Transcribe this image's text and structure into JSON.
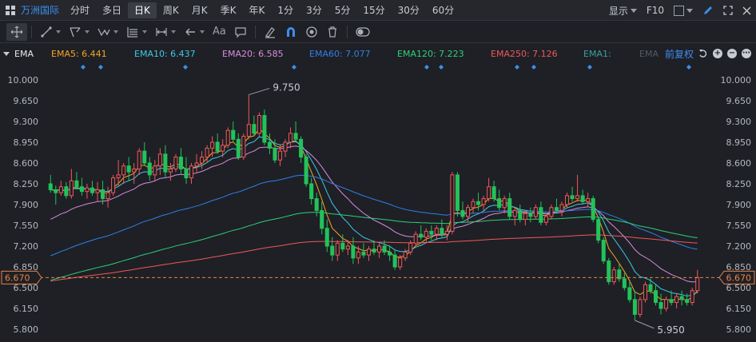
{
  "stock": {
    "name": "万洲国际"
  },
  "periods": [
    "分时",
    "多日",
    "日K",
    "周K",
    "月K",
    "季K",
    "年K",
    "1分",
    "3分",
    "5分",
    "15分",
    "30分",
    "60分"
  ],
  "active_period": "日K",
  "top_right": {
    "display_label": "显示",
    "f10_label": "F10"
  },
  "toolbar": {
    "tools": [
      {
        "name": "move-tool",
        "icon": "cross-arrows-icon",
        "caret": false,
        "active": true
      },
      {
        "name": "line-tool",
        "icon": "line-icon",
        "caret": true
      },
      {
        "name": "channel-tool",
        "icon": "channel-icon",
        "caret": true
      },
      {
        "name": "wave-tool",
        "icon": "wave-icon",
        "caret": true
      },
      {
        "name": "fib-tool",
        "icon": "fib-icon",
        "caret": true
      },
      {
        "name": "range-tool",
        "icon": "range-icon",
        "caret": true
      },
      {
        "name": "arrow-tool",
        "icon": "arrow-left-icon",
        "caret": true
      },
      {
        "name": "text-tool",
        "icon": "text-icon",
        "caret": false
      },
      {
        "name": "comment-tool",
        "icon": "comment-icon",
        "caret": false
      }
    ],
    "text_tool_label": "Aa"
  },
  "indicator": {
    "name": "EMA",
    "items": [
      {
        "label": "EMA5: 6.441",
        "color": "#f5a623"
      },
      {
        "label": "EMA10: 6.437",
        "color": "#3fc8e8"
      },
      {
        "label": "EMA20: 6.585",
        "color": "#d98be0"
      },
      {
        "label": "EMA60: 7.077",
        "color": "#2f7fe8"
      },
      {
        "label": "EMA120: 7.223",
        "color": "#2fcf7a"
      },
      {
        "label": "EMA250: 7.126",
        "color": "#f0575a"
      },
      {
        "label": "EMA1:",
        "color": "#3aa0a0"
      },
      {
        "label": "EMA",
        "color": "#555a62"
      }
    ],
    "adjust_label": "前复权"
  },
  "chart_data": {
    "type": "candlestick",
    "y_ticks": [
      "10.000",
      "9.650",
      "9.300",
      "8.950",
      "8.600",
      "8.250",
      "7.900",
      "7.550",
      "7.200",
      "6.850",
      "6.500",
      "6.150",
      "5.800"
    ],
    "ylim": [
      5.8,
      10.0
    ],
    "current_price": "6.670",
    "high_label": "9.750",
    "low_label": "5.950",
    "up_color": "#f0575a",
    "down_color": "#23c25a",
    "candles": [
      [
        8.25,
        8.4,
        8.1,
        8.15
      ],
      [
        8.15,
        8.22,
        7.9,
        8.1
      ],
      [
        8.1,
        8.3,
        8.05,
        8.2
      ],
      [
        8.2,
        8.28,
        8.0,
        8.05
      ],
      [
        8.05,
        8.5,
        8.0,
        8.3
      ],
      [
        8.3,
        8.45,
        8.15,
        8.2
      ],
      [
        8.2,
        8.35,
        8.05,
        8.12
      ],
      [
        8.12,
        8.25,
        8.0,
        8.18
      ],
      [
        8.18,
        8.3,
        8.05,
        8.1
      ],
      [
        8.1,
        8.28,
        7.95,
        8.15
      ],
      [
        8.15,
        8.3,
        7.9,
        8.0
      ],
      [
        8.0,
        8.2,
        7.85,
        8.1
      ],
      [
        8.1,
        8.4,
        8.05,
        8.35
      ],
      [
        8.35,
        8.65,
        8.2,
        8.4
      ],
      [
        8.4,
        8.6,
        8.25,
        8.55
      ],
      [
        8.55,
        8.7,
        8.3,
        8.45
      ],
      [
        8.45,
        8.6,
        8.25,
        8.5
      ],
      [
        8.5,
        8.85,
        8.4,
        8.8
      ],
      [
        8.8,
        8.95,
        8.55,
        8.6
      ],
      [
        8.6,
        8.7,
        8.3,
        8.4
      ],
      [
        8.4,
        8.65,
        8.3,
        8.55
      ],
      [
        8.55,
        8.85,
        8.4,
        8.75
      ],
      [
        8.75,
        8.9,
        8.35,
        8.45
      ],
      [
        8.45,
        8.6,
        8.3,
        8.5
      ],
      [
        8.5,
        8.75,
        8.45,
        8.7
      ],
      [
        8.7,
        8.85,
        8.4,
        8.5
      ],
      [
        8.5,
        8.7,
        8.25,
        8.35
      ],
      [
        8.35,
        8.6,
        8.25,
        8.55
      ],
      [
        8.55,
        8.75,
        8.45,
        8.6
      ],
      [
        8.6,
        8.8,
        8.5,
        8.7
      ],
      [
        8.7,
        8.9,
        8.6,
        8.85
      ],
      [
        8.85,
        9.05,
        8.7,
        8.95
      ],
      [
        8.95,
        9.1,
        8.75,
        8.8
      ],
      [
        8.8,
        9.0,
        8.7,
        8.9
      ],
      [
        8.9,
        9.2,
        8.85,
        9.15
      ],
      [
        9.15,
        9.3,
        8.95,
        9.0
      ],
      [
        9.0,
        9.1,
        8.65,
        8.7
      ],
      [
        8.7,
        9.1,
        8.65,
        9.05
      ],
      [
        9.05,
        9.75,
        9.0,
        9.25
      ],
      [
        9.25,
        9.4,
        9.05,
        9.1
      ],
      [
        9.1,
        9.45,
        9.05,
        9.4
      ],
      [
        9.4,
        9.5,
        8.9,
        8.95
      ],
      [
        8.95,
        9.1,
        8.75,
        8.85
      ],
      [
        8.85,
        9.0,
        8.6,
        8.65
      ],
      [
        8.65,
        8.9,
        8.55,
        8.8
      ],
      [
        8.8,
        9.0,
        8.7,
        8.95
      ],
      [
        8.95,
        9.2,
        8.85,
        9.1
      ],
      [
        9.1,
        9.3,
        8.95,
        9.0
      ],
      [
        9.0,
        9.05,
        8.6,
        8.7
      ],
      [
        8.7,
        8.75,
        8.2,
        8.25
      ],
      [
        8.25,
        8.35,
        7.9,
        8.0
      ],
      [
        8.0,
        8.1,
        7.7,
        7.8
      ],
      [
        7.8,
        7.95,
        7.4,
        7.5
      ],
      [
        7.5,
        7.65,
        7.1,
        7.2
      ],
      [
        7.2,
        7.35,
        6.95,
        7.05
      ],
      [
        7.05,
        7.3,
        6.95,
        7.25
      ],
      [
        7.25,
        7.4,
        7.1,
        7.15
      ],
      [
        7.15,
        7.3,
        7.05,
        7.2
      ],
      [
        7.2,
        7.35,
        6.9,
        7.0
      ],
      [
        7.0,
        7.2,
        6.9,
        7.1
      ],
      [
        7.1,
        7.25,
        7.0,
        7.05
      ],
      [
        7.05,
        7.2,
        6.95,
        7.15
      ],
      [
        7.15,
        7.3,
        7.05,
        7.1
      ],
      [
        7.1,
        7.25,
        7.0,
        7.2
      ],
      [
        7.2,
        7.3,
        7.05,
        7.1
      ],
      [
        7.1,
        7.2,
        6.95,
        7.05
      ],
      [
        7.05,
        7.15,
        6.8,
        6.85
      ],
      [
        6.85,
        7.05,
        6.8,
        7.0
      ],
      [
        7.0,
        7.15,
        6.95,
        7.1
      ],
      [
        7.1,
        7.3,
        7.05,
        7.25
      ],
      [
        7.25,
        7.45,
        7.2,
        7.4
      ],
      [
        7.4,
        7.55,
        7.3,
        7.35
      ],
      [
        7.35,
        7.5,
        7.25,
        7.45
      ],
      [
        7.45,
        7.55,
        7.3,
        7.4
      ],
      [
        7.4,
        7.55,
        7.3,
        7.5
      ],
      [
        7.5,
        7.65,
        7.35,
        7.4
      ],
      [
        7.4,
        7.55,
        7.3,
        7.45
      ],
      [
        7.45,
        8.45,
        7.4,
        8.4
      ],
      [
        8.4,
        8.45,
        7.7,
        7.8
      ],
      [
        7.8,
        7.95,
        7.65,
        7.7
      ],
      [
        7.7,
        7.9,
        7.6,
        7.85
      ],
      [
        7.85,
        8.0,
        7.75,
        7.95
      ],
      [
        7.95,
        8.1,
        7.8,
        7.9
      ],
      [
        7.9,
        8.05,
        7.8,
        8.0
      ],
      [
        8.0,
        8.35,
        7.95,
        8.2
      ],
      [
        8.2,
        8.3,
        7.95,
        8.0
      ],
      [
        8.0,
        8.15,
        7.8,
        7.85
      ],
      [
        7.85,
        8.05,
        7.75,
        8.0
      ],
      [
        8.0,
        8.1,
        7.65,
        7.7
      ],
      [
        7.7,
        7.85,
        7.55,
        7.8
      ],
      [
        7.8,
        7.9,
        7.6,
        7.65
      ],
      [
        7.65,
        7.8,
        7.55,
        7.75
      ],
      [
        7.75,
        7.85,
        7.6,
        7.7
      ],
      [
        7.7,
        7.9,
        7.65,
        7.85
      ],
      [
        7.85,
        7.95,
        7.55,
        7.6
      ],
      [
        7.6,
        7.75,
        7.55,
        7.7
      ],
      [
        7.7,
        7.9,
        7.65,
        7.85
      ],
      [
        7.85,
        8.0,
        7.75,
        7.8
      ],
      [
        7.8,
        7.95,
        7.7,
        7.9
      ],
      [
        7.9,
        8.1,
        7.85,
        8.05
      ],
      [
        8.05,
        8.2,
        7.95,
        8.0
      ],
      [
        8.0,
        8.4,
        7.95,
        8.05
      ],
      [
        8.05,
        8.15,
        7.9,
        7.95
      ],
      [
        7.95,
        8.1,
        7.85,
        8.0
      ],
      [
        8.0,
        8.05,
        7.6,
        7.65
      ],
      [
        7.65,
        7.7,
        7.25,
        7.3
      ],
      [
        7.3,
        7.35,
        6.9,
        6.95
      ],
      [
        6.95,
        7.0,
        6.55,
        6.6
      ],
      [
        6.6,
        6.85,
        6.55,
        6.8
      ],
      [
        6.8,
        6.9,
        6.6,
        6.65
      ],
      [
        6.65,
        6.75,
        6.45,
        6.5
      ],
      [
        6.5,
        6.6,
        6.25,
        6.3
      ],
      [
        6.3,
        6.45,
        5.95,
        6.05
      ],
      [
        6.05,
        6.35,
        6.0,
        6.3
      ],
      [
        6.3,
        6.6,
        6.25,
        6.55
      ],
      [
        6.55,
        6.65,
        6.4,
        6.45
      ],
      [
        6.45,
        6.55,
        6.2,
        6.25
      ],
      [
        6.25,
        6.4,
        6.05,
        6.15
      ],
      [
        6.15,
        6.35,
        6.1,
        6.3
      ],
      [
        6.3,
        6.45,
        6.2,
        6.25
      ],
      [
        6.25,
        6.4,
        6.15,
        6.35
      ],
      [
        6.35,
        6.45,
        6.2,
        6.3
      ],
      [
        6.3,
        6.4,
        6.2,
        6.25
      ],
      [
        6.25,
        6.5,
        6.2,
        6.45
      ],
      [
        6.45,
        6.8,
        6.4,
        6.67
      ]
    ]
  }
}
